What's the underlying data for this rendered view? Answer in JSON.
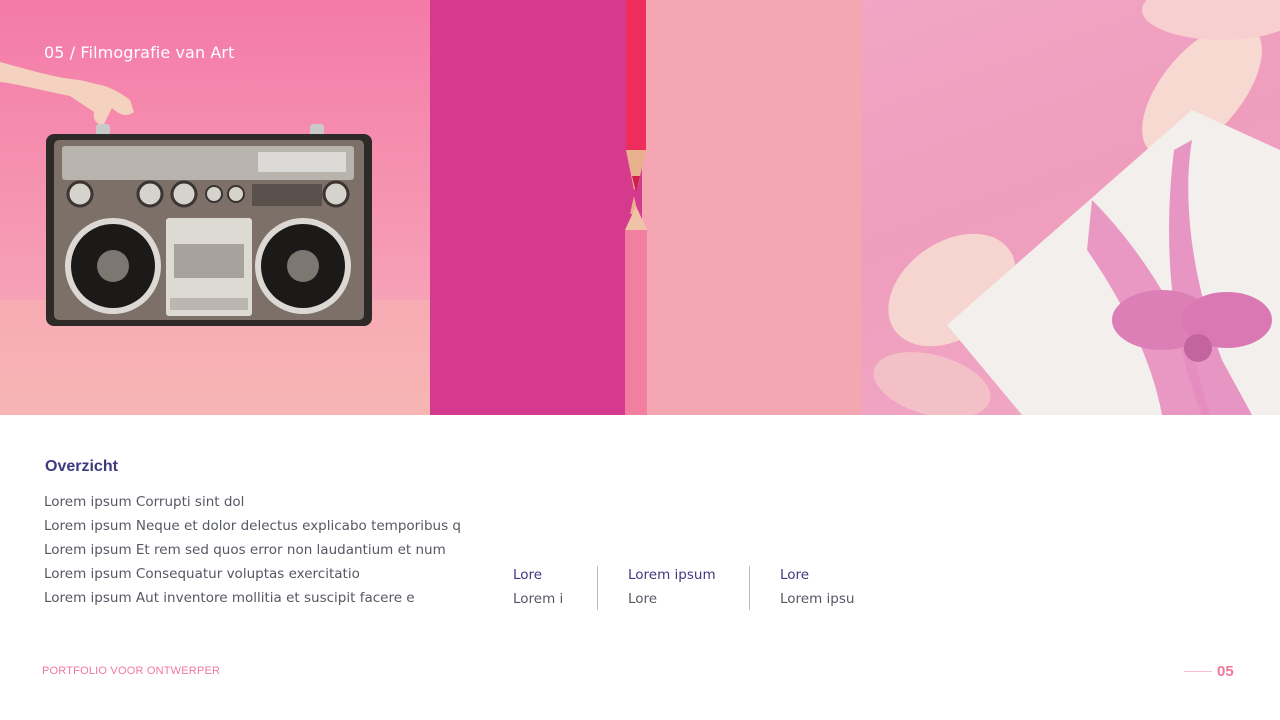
{
  "header": {
    "title": "05 / Filmografie van Art"
  },
  "overview": {
    "heading": "Overzicht",
    "lines": [
      "Lorem ipsum Corrupti sint dol",
      "Lorem ipsum Neque et dolor delectus explicabo temporibus q",
      "Lorem ipsum Et rem sed quos error non laudantium et num",
      "Lorem ipsum Consequatur voluptas exercitatio",
      "Lorem ipsum Aut inventore mollitia et suscipit facere e"
    ]
  },
  "stats": [
    {
      "label": "Lore",
      "value": "Lorem i"
    },
    {
      "label": "Lorem ipsum",
      "value": "Lore"
    },
    {
      "label": "Lore",
      "value": "Lorem ipsu"
    }
  ],
  "footer": {
    "left_text": "PORTFOLIO VOOR ONTWERPER",
    "page_number": "05"
  },
  "colors": {
    "heading": "#3e3a7e",
    "accent_pink": "#f2789c",
    "body_text": "#555863"
  }
}
